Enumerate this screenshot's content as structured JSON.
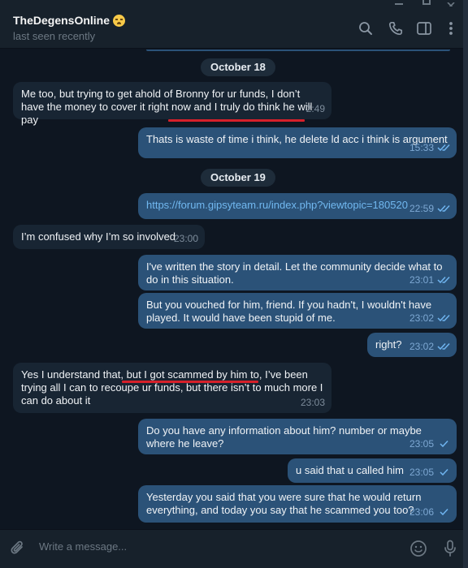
{
  "header": {
    "title": "TheDegensOnline",
    "title_emoji": "woozy-face-emoji",
    "status": "last seen recently",
    "icons": [
      "search-icon",
      "phone-icon",
      "sidebar-toggle-icon",
      "more-vert-icon"
    ]
  },
  "dates": [
    "October 18",
    "October 19"
  ],
  "messages": [
    {
      "dir": "in",
      "text": "Me too, but trying to get ahold of Bronny for ur funds, I don’t have the money to cover it right now and I truly do think he will pay",
      "time": "2:49",
      "ticks": ""
    },
    {
      "dir": "out",
      "text": "Thats is waste of time i think, he delete ld acc i think is argument",
      "time": "15:33",
      "ticks": "read"
    },
    {
      "dir": "out",
      "text": "https://forum.gipsyteam.ru/index.php?viewtopic=180520",
      "time": "22:59",
      "ticks": "read"
    },
    {
      "dir": "in",
      "text": "I’m confused why I’m so involved",
      "time": "23:00",
      "ticks": ""
    },
    {
      "dir": "out",
      "text": "I've written the story in detail. Let the community decide what to do in this situation.",
      "time": "23:01",
      "ticks": "read"
    },
    {
      "dir": "out",
      "text": "But you vouched for him, friend. If you hadn't, I wouldn't have played. It would have been stupid of me.",
      "time": "23:02",
      "ticks": "read"
    },
    {
      "dir": "out",
      "text": "right?",
      "time": "23:02",
      "ticks": "read"
    },
    {
      "dir": "in",
      "text": "Yes I understand that, but I got scammed by him to, I’ve been trying all I can to recoupe ur funds, but there isn’t to much more I can do about it",
      "time": "23:03",
      "ticks": ""
    },
    {
      "dir": "out",
      "text": "Do you have any information about him? number or maybe where he leave?",
      "time": "23:05",
      "ticks": "sent"
    },
    {
      "dir": "out",
      "text": "u said that u called him",
      "time": "23:05",
      "ticks": "sent"
    },
    {
      "dir": "out",
      "text": "Yesterday you said that you were sure that he would return everything, and today you say that he scammed you too?",
      "time": "23:06",
      "ticks": "sent"
    }
  ],
  "input": {
    "placeholder": "Write a message..."
  },
  "colors": {
    "background": "#0e1621",
    "incoming_bubble": "#182533",
    "outgoing_bubble": "#2b5278",
    "link": "#71b8f0",
    "annotation_underline": "#d6202a"
  }
}
